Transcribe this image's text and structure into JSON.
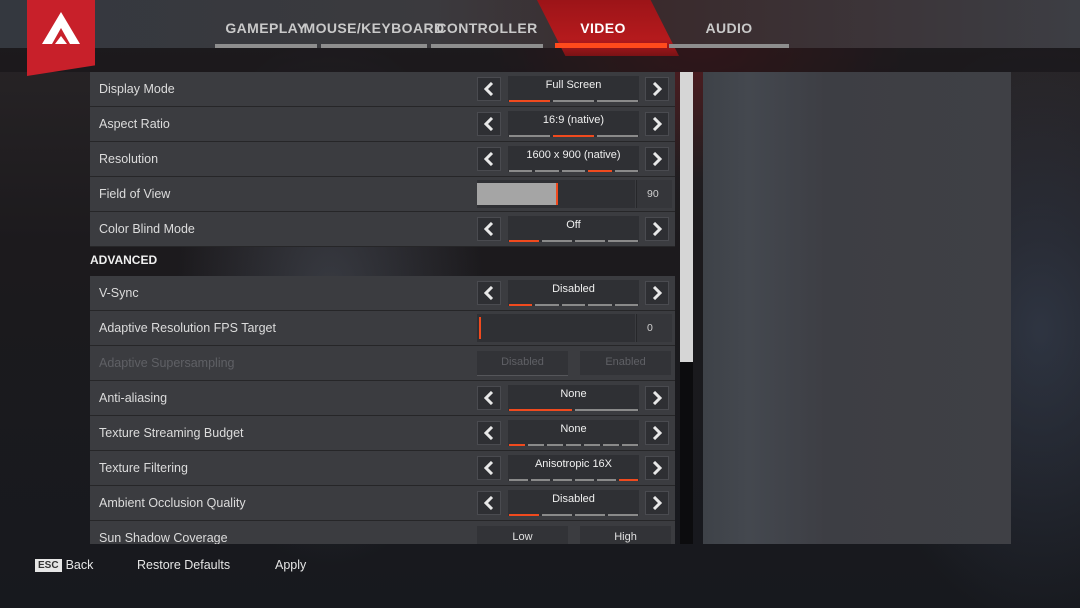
{
  "app": {
    "logo": "apex-logo-icon"
  },
  "tabs": [
    {
      "label": "GAMEPLAY",
      "active": false
    },
    {
      "label": "MOUSE/KEYBOARD",
      "active": false
    },
    {
      "label": "CONTROLLER",
      "active": false
    },
    {
      "label": "VIDEO",
      "active": true
    },
    {
      "label": "AUDIO",
      "active": false
    }
  ],
  "settings": {
    "display_mode": {
      "label": "Display Mode",
      "value": "Full Screen",
      "options_count": 3,
      "selected_index": 0
    },
    "aspect_ratio": {
      "label": "Aspect Ratio",
      "value": "16:9 (native)",
      "options_count": 3,
      "selected_index": 1
    },
    "resolution": {
      "label": "Resolution",
      "value": "1600 x 900 (native)",
      "options_count": 5,
      "selected_index": 3
    },
    "field_of_view": {
      "label": "Field of View",
      "value": "90",
      "fill_fraction": 0.5
    },
    "color_blind_mode": {
      "label": "Color Blind Mode",
      "value": "Off",
      "options_count": 4,
      "selected_index": 0
    },
    "advanced_header": "ADVANCED",
    "vsync": {
      "label": "V-Sync",
      "value": "Disabled",
      "options_count": 5,
      "selected_index": 0
    },
    "adaptive_res_fps": {
      "label": "Adaptive Resolution FPS Target",
      "value": "0",
      "fill_fraction": 0
    },
    "adaptive_supersampling": {
      "label": "Adaptive Supersampling",
      "option_a": "Disabled",
      "option_b": "Enabled",
      "disabled": true
    },
    "anti_aliasing": {
      "label": "Anti-aliasing",
      "value": "None",
      "options_count": 2,
      "selected_index": 0
    },
    "texture_streaming": {
      "label": "Texture Streaming Budget",
      "value": "None",
      "options_count": 7,
      "selected_index": 0
    },
    "texture_filtering": {
      "label": "Texture Filtering",
      "value": "Anisotropic 16X",
      "options_count": 6,
      "selected_index": 5
    },
    "ambient_occlusion": {
      "label": "Ambient Occlusion Quality",
      "value": "Disabled",
      "options_count": 4,
      "selected_index": 0
    },
    "sun_shadow": {
      "label": "Sun Shadow Coverage",
      "option_a": "Low",
      "option_b": "High"
    }
  },
  "footer": {
    "esc_key": "ESC",
    "back": "Back",
    "restore": "Restore Defaults",
    "apply": "Apply"
  },
  "colors": {
    "accent": "#f04a1e",
    "brand_red": "#c8202a"
  }
}
